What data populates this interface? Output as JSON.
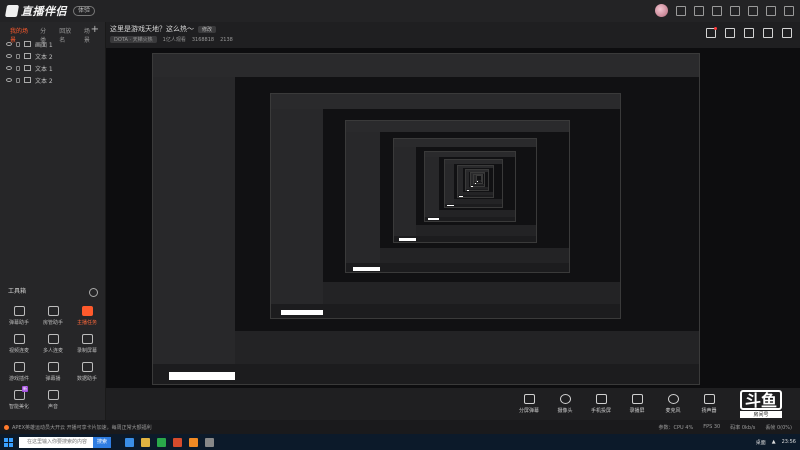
{
  "app": {
    "name": "直播伴侣",
    "badge": "体验"
  },
  "sidebar": {
    "tabs": [
      {
        "label": "我的场景",
        "active": true
      },
      {
        "label": "分类"
      },
      {
        "label": "回放名"
      },
      {
        "label": "场景"
      }
    ],
    "scenes": [
      {
        "label": "画面 1"
      },
      {
        "label": "文本 2"
      },
      {
        "label": "文本 1"
      },
      {
        "label": "文本 2"
      }
    ],
    "toolbox_title": "工具箱",
    "tools": [
      {
        "label": "弹幕助手",
        "hot": false,
        "tag": ""
      },
      {
        "label": "房管助手",
        "hot": false,
        "tag": ""
      },
      {
        "label": "主播任务",
        "hot": true,
        "tag": ""
      },
      {
        "label": "视频连麦",
        "hot": false,
        "tag": ""
      },
      {
        "label": "多人连麦",
        "hot": false,
        "tag": ""
      },
      {
        "label": "录制屏幕",
        "hot": false,
        "tag": ""
      },
      {
        "label": "游戏插件",
        "hot": false,
        "tag": ""
      },
      {
        "label": "弹幕播",
        "hot": false,
        "tag": ""
      },
      {
        "label": "数据助手",
        "hot": false,
        "tag": ""
      },
      {
        "label": "智能美化",
        "hot": false,
        "tag": "新"
      },
      {
        "label": "声音",
        "hot": false,
        "tag": ""
      }
    ]
  },
  "header": {
    "title": "这里是游戏天地？这么热～",
    "edit_label": "修改",
    "category": "DOTA · 天梯火热",
    "viewers": "1亿人观看",
    "room_id": "3168818",
    "heat": "2138"
  },
  "bottom_actions": [
    {
      "label": "分屏弹幕"
    },
    {
      "label": "摄像头"
    },
    {
      "label": "手机投屏"
    },
    {
      "label": "录播屏"
    },
    {
      "label": "麦克风"
    },
    {
      "label": "扬声器"
    }
  ],
  "brand": {
    "mark": "斗鱼",
    "label": "房间号",
    "room_number": "3168818"
  },
  "status": {
    "left": "APEX英雄运动员大开云  开播可享卡片加速，每周正常大额福利",
    "right": [
      "参数：CPU 4%",
      "FPS 30",
      "码率 0kb/s",
      "丢帧 0(0%)"
    ]
  },
  "taskbar": {
    "search_placeholder": "在这里输入你要搜索的内容",
    "search_button": "搜索",
    "time": "23:56",
    "tray_label": "桌面"
  },
  "colors": {
    "accent": "#ff5a2c",
    "bg": "#1c1c1e"
  }
}
